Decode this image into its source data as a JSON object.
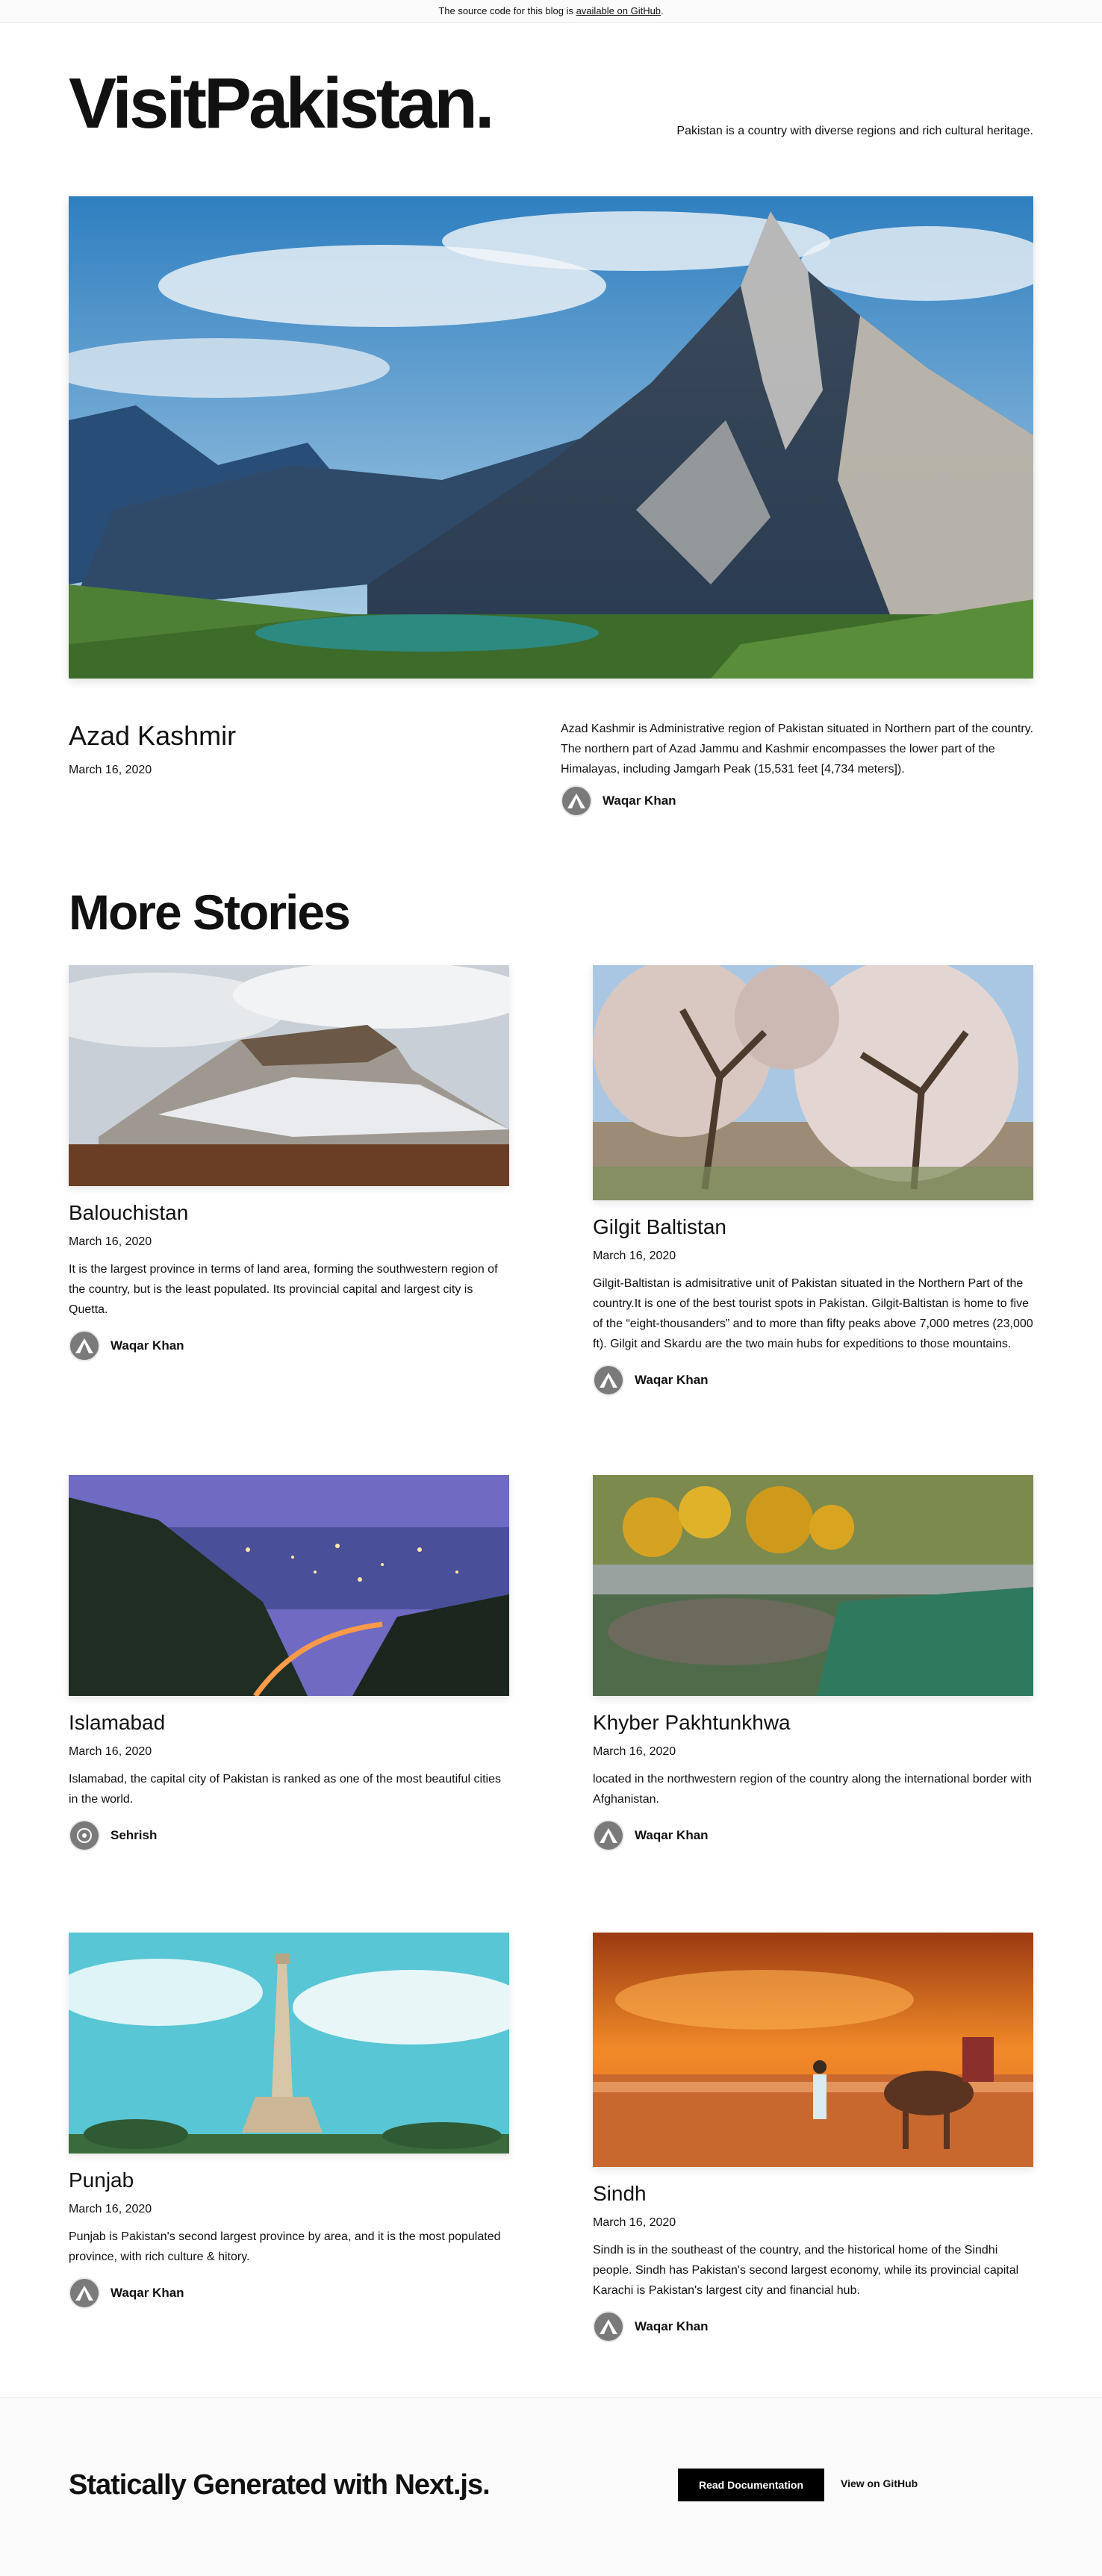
{
  "banner": {
    "text": "The source code for this blog is ",
    "link": "available on GitHub",
    "end": "."
  },
  "header": {
    "logo": "VisitPakistan.",
    "tagline": "Pakistan is a country with diverse regions and rich cultural heritage."
  },
  "hero": {
    "title": "Azad Kashmir",
    "date": "March 16, 2020",
    "excerpt": "Azad Kashmir is Administrative region of Pakistan situated in Northern part of the country. The northern part of Azad Jammu and Kashmir encompasses the lower part of the Himalayas, including Jamgarh Peak (15,531 feet [4,734 meters]).",
    "author": "Waqar Khan"
  },
  "more": {
    "title": "More Stories"
  },
  "stories": [
    {
      "title": "Balouchistan",
      "date": "March 16, 2020",
      "excerpt": "It is the largest province in terms of land area, forming the southwestern region of the country, but is the least populated. Its provincial capital and largest city is Quetta.",
      "author": "Waqar Khan"
    },
    {
      "title": "Gilgit Baltistan",
      "date": "March 16, 2020",
      "excerpt": "Gilgit-Baltistan is admisitrative unit of Pakistan situated in the Northern Part of the country.It is one of the best tourist spots in Pakistan. Gilgit-Baltistan is home to five of the “eight-thousanders” and to more than fifty peaks above 7,000 metres (23,000 ft). Gilgit and Skardu are the two main hubs for expeditions to those mountains.",
      "author": "Waqar Khan"
    },
    {
      "title": "Islamabad",
      "date": "March 16, 2020",
      "excerpt": "Islamabad, the capital city of Pakistan is ranked as one of the most beautiful cities in the world.",
      "author": "Sehrish"
    },
    {
      "title": "Khyber Pakhtunkhwa",
      "date": "March 16, 2020",
      "excerpt": "located in the northwestern region of the country along the international border with Afghanistan.",
      "author": "Waqar Khan"
    },
    {
      "title": "Punjab",
      "date": "March 16, 2020",
      "excerpt": "Punjab is Pakistan's second largest province by area, and it is the most populated province, with rich culture & hitory.",
      "author": "Waqar Khan"
    },
    {
      "title": "Sindh",
      "date": "March 16, 2020",
      "excerpt": "Sindh is in the southeast of the country, and the historical home of the Sindhi people. Sindh has Pakistan's second largest economy, while its provincial capital Karachi is Pakistan's largest city and financial hub.",
      "author": "Waqar Khan"
    }
  ],
  "footer": {
    "title": "Statically Generated with Next.js.",
    "docs_button": "Read Documentation",
    "github_link": "View on GitHub"
  }
}
